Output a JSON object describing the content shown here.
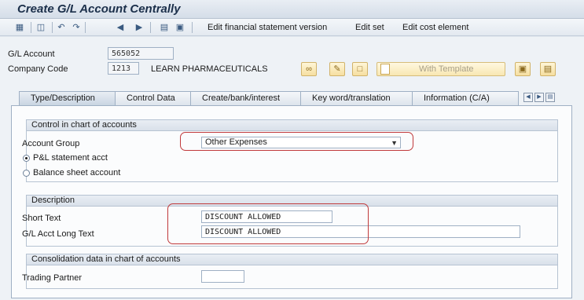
{
  "window": {
    "title": "Create G/L Account Centrally"
  },
  "toolbar": {
    "icons": [
      "new-icon",
      "copy-icon",
      "undo-icon",
      "redo-icon",
      "previous-icon",
      "next-icon",
      "hierarchy-icon",
      "document-icon"
    ],
    "links": [
      "Edit financial statement version",
      "Edit set",
      "Edit cost element"
    ]
  },
  "header": {
    "gl_account_label": "G/L Account",
    "gl_account_value": "565052",
    "company_code_label": "Company Code",
    "company_code_value": "1213",
    "company_name": "LEARN PHARMACEUTICALS",
    "with_template_label": "With Template"
  },
  "tabs": [
    {
      "label": "Type/Description",
      "active": true
    },
    {
      "label": "Control Data",
      "active": false
    },
    {
      "label": "Create/bank/interest",
      "active": false
    },
    {
      "label": "Key word/translation",
      "active": false
    },
    {
      "label": "Information (C/A)",
      "active": false
    }
  ],
  "control_group": {
    "title": "Control in chart of accounts",
    "account_group_label": "Account Group",
    "account_group_value": "Other Expenses",
    "pl_label": "P&L statement acct",
    "balance_label": "Balance sheet account",
    "selected": "pl"
  },
  "description_group": {
    "title": "Description",
    "short_text_label": "Short Text",
    "short_text_value": "DISCOUNT ALLOWED",
    "long_text_label": "G/L Acct Long Text",
    "long_text_value": "DISCOUNT ALLOWED"
  },
  "consolidation_group": {
    "title": "Consolidation data in chart of accounts",
    "trading_partner_label": "Trading Partner",
    "trading_partner_value": ""
  },
  "colors": {
    "highlight": "#c0393b",
    "title": "#1b2f4a"
  }
}
